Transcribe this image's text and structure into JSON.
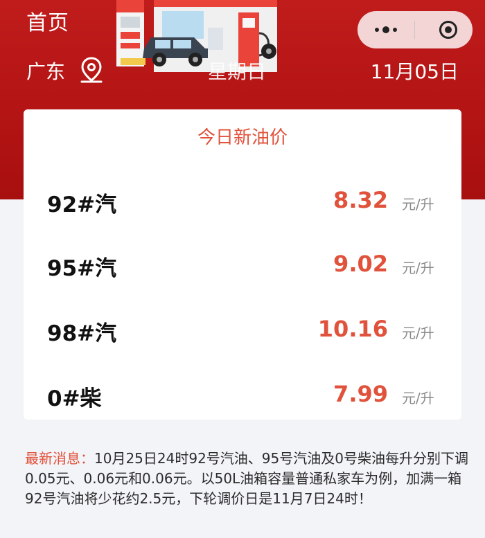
{
  "header": {
    "title": "首页",
    "province": "广东",
    "weekday": "星期日",
    "date": "11月05日",
    "bg_color": "#b41414"
  },
  "price_card": {
    "title": "今日新油价",
    "accent_color": "#e0523b",
    "rows": [
      {
        "name": "92#汽",
        "price": "8.32",
        "unit": "元/升"
      },
      {
        "name": "95#汽",
        "price": "9.02",
        "unit": "元/升"
      },
      {
        "name": "98#汽",
        "price": "10.16",
        "unit": "元/升"
      },
      {
        "name": "0#柴",
        "price": "7.99",
        "unit": "元/升"
      }
    ]
  },
  "news": {
    "label": "最新消息：",
    "text": "10月25日24时92号汽油、95号汽油及0号柴油每升分别下调0.05元、0.06元和0.06元。以50L油箱容量普通私家车为例，加满一箱92号汽油将少花约2.5元，下轮调价日是11月7日24时！"
  },
  "icons": {
    "location": "location-pin-icon",
    "more": "more-dots-icon",
    "close": "close-miniprogram-icon"
  }
}
